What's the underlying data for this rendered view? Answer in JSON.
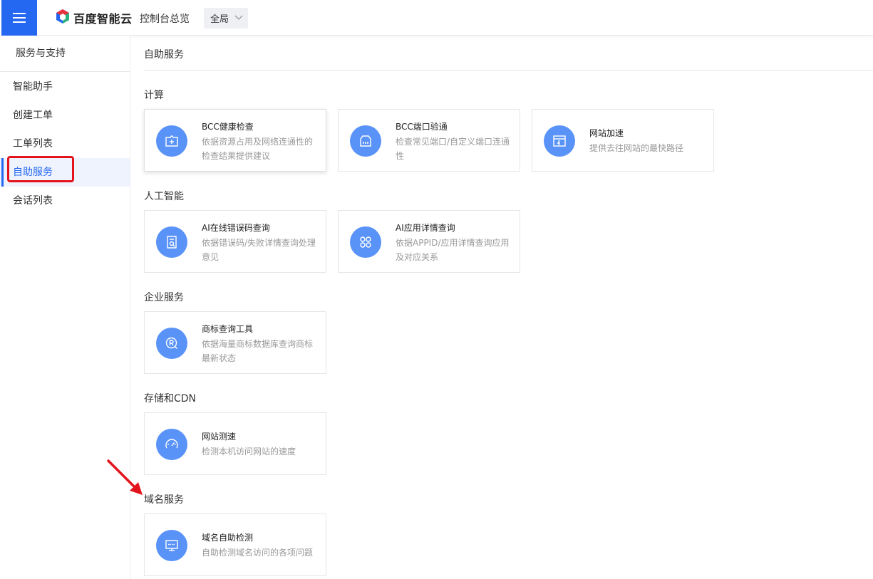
{
  "header": {
    "logo_text": "百度智能云",
    "overview_link": "控制台总览",
    "region_selected": "全局"
  },
  "sidebar": {
    "heading": "服务与支持",
    "items": [
      {
        "label": "智能助手"
      },
      {
        "label": "创建工单"
      },
      {
        "label": "工单列表"
      },
      {
        "label": "自助服务",
        "active": true
      },
      {
        "label": "会话列表"
      }
    ]
  },
  "main": {
    "title": "自助服务",
    "sections": [
      {
        "title": "计算",
        "cards": [
          {
            "title": "BCC健康检查",
            "desc": "依据资源占用及网络连通性的检查结果提供建议",
            "icon": "health-check-icon"
          },
          {
            "title": "BCC端口验通",
            "desc": "检查常见端口/自定义端口连通性",
            "icon": "port-icon"
          },
          {
            "title": "网站加速",
            "desc": "提供去往网站的最快路径",
            "icon": "website-accelerate-icon"
          }
        ]
      },
      {
        "title": "人工智能",
        "cards": [
          {
            "title": "AI在线错误码查询",
            "desc": "依据错误码/失败详情查询处理意见",
            "icon": "error-code-search-icon"
          },
          {
            "title": "AI应用详情查询",
            "desc": "依据APPID/应用详情查询应用及对应关系",
            "icon": "app-grid-icon"
          }
        ]
      },
      {
        "title": "企业服务",
        "cards": [
          {
            "title": "商标查询工具",
            "desc": "依据海量商标数据库查询商标最新状态",
            "icon": "trademark-search-icon"
          }
        ]
      },
      {
        "title": "存储和CDN",
        "cards": [
          {
            "title": "网站测速",
            "desc": "检测本机访问网站的速度",
            "icon": "speedometer-icon"
          }
        ]
      },
      {
        "title": "域名服务",
        "cards": [
          {
            "title": "域名自助检测",
            "desc": "自助检测域名访问的各项问题",
            "icon": "domain-monitor-icon"
          }
        ]
      }
    ]
  },
  "colors": {
    "brand_blue": "#2468f2",
    "icon_blue": "#5a93f7",
    "highlight_red": "#e3141c"
  }
}
